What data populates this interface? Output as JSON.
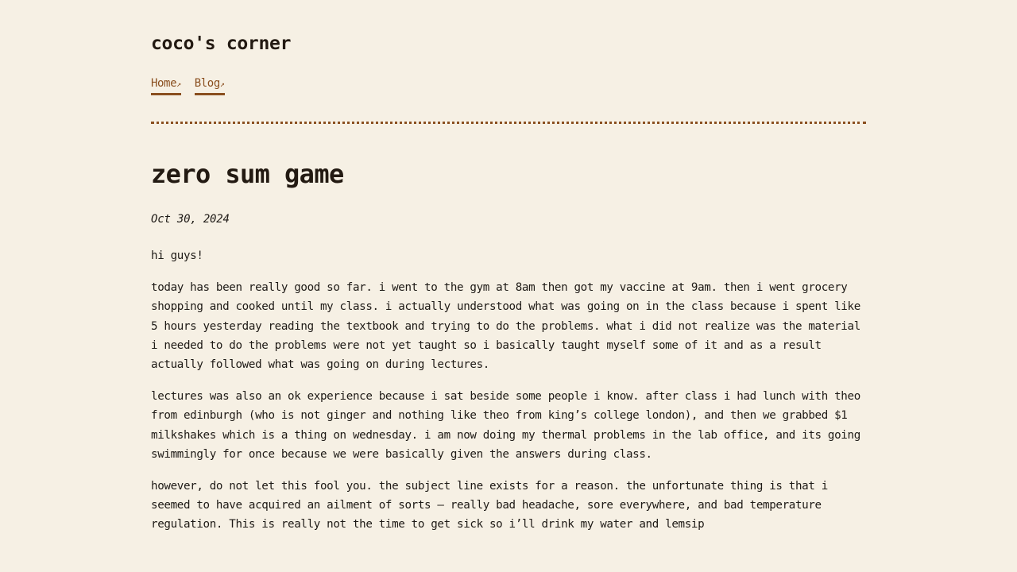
{
  "site": {
    "title": "coco's corner"
  },
  "nav": {
    "items": [
      {
        "label": "Home",
        "arrow": "↗"
      },
      {
        "label": "Blog",
        "arrow": "↗"
      }
    ]
  },
  "post": {
    "title": "zero sum game",
    "date": "Oct 30, 2024",
    "paragraphs": [
      "hi guys!",
      "today has been really good so far. i went to the gym at 8am then got my vaccine at 9am. then i went grocery shopping and cooked until my class. i actually understood what was going on in the class because i spent like 5 hours yesterday reading the textbook and trying to do the problems. what i did not realize was the material i needed to do the problems were not yet taught so i basically taught myself some of it and as a result actually followed what was going on during lectures.",
      "lectures was also an ok experience because i sat beside some people i know. after class i had lunch with theo from edinburgh (who is not ginger and nothing like theo from king’s college london), and then we grabbed $1 milkshakes which is a thing on wednesday. i am now doing my thermal problems in the lab office, and its going swimmingly for once because we were basically given the answers during class.",
      "however, do not let this fool you. the subject line exists for a reason. the unfortunate thing is that i seemed to have acquired an ailment of sorts — really bad headache, sore everywhere, and bad temperature regulation. This is really not the time to get sick so i’ll drink my water and lemsip"
    ]
  },
  "colors": {
    "background": "#f6f0e4",
    "accent": "#8a4f1f",
    "text": "#1e1a16"
  }
}
